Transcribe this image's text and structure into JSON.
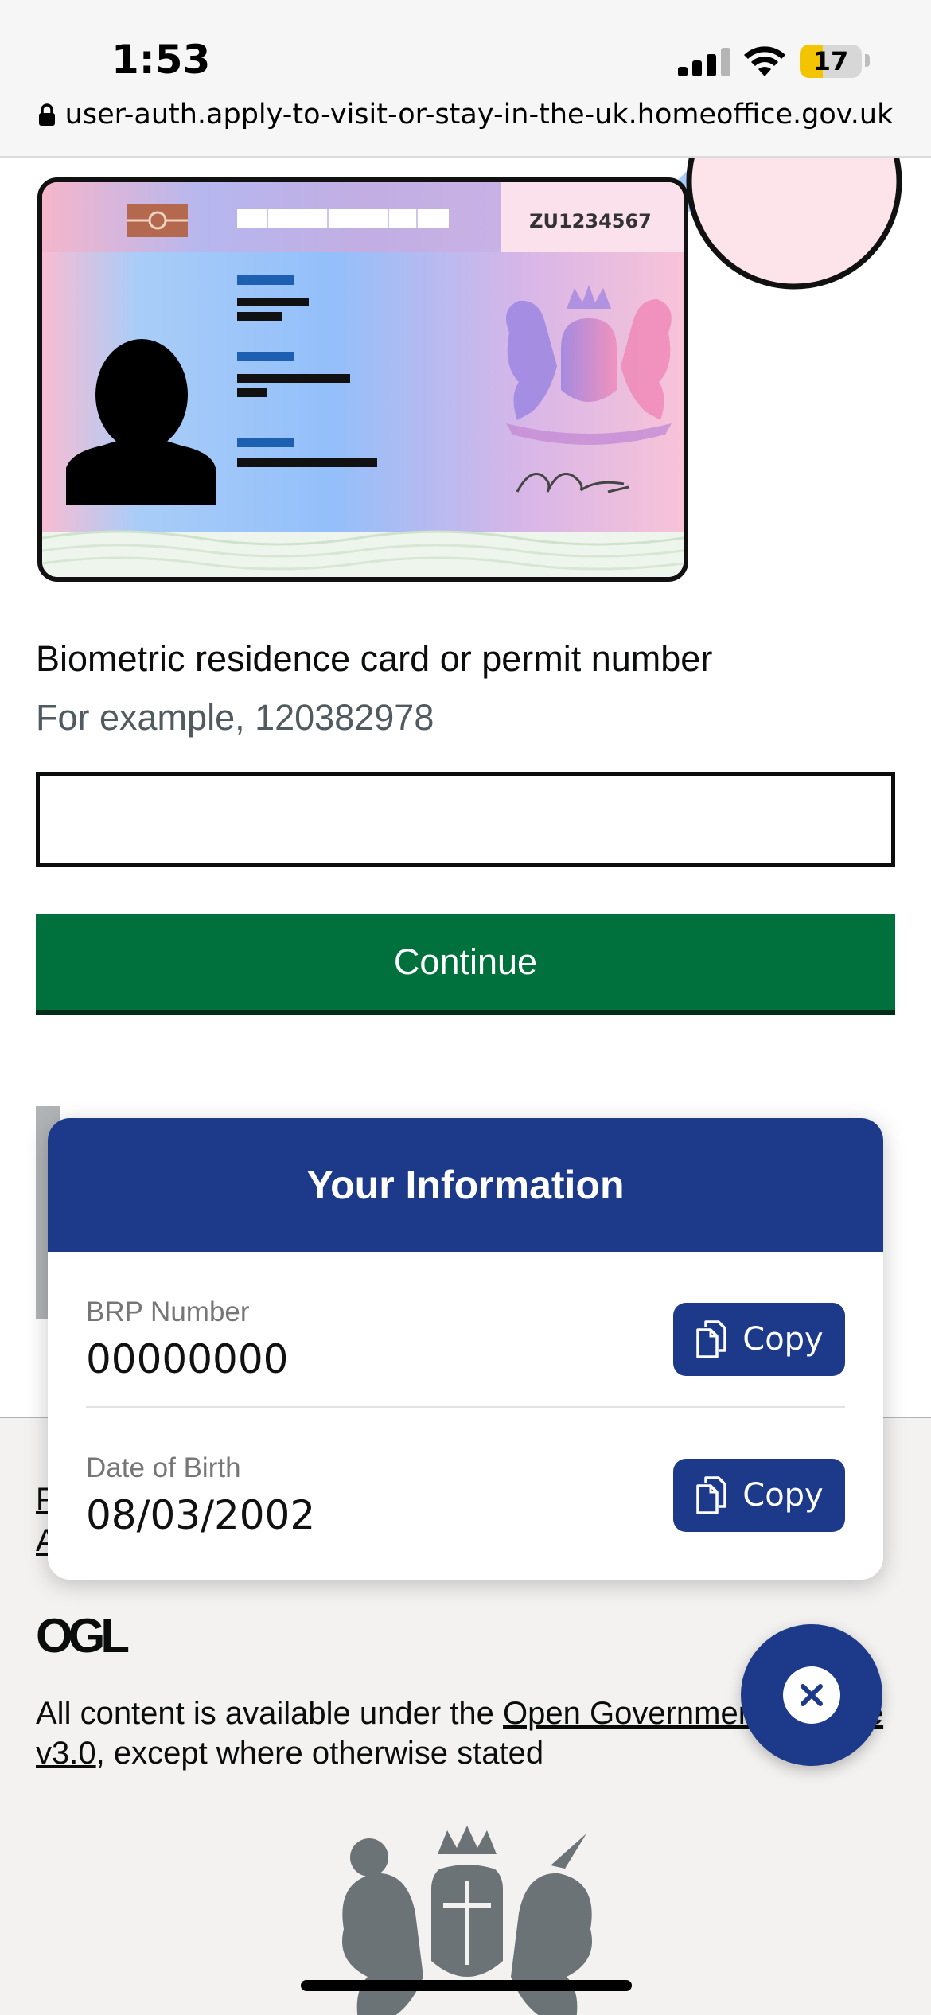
{
  "status_bar": {
    "time": "1:53",
    "battery_level": "17",
    "url": "user-auth.apply-to-visit-or-stay-in-the-uk.homeoffice.gov.uk"
  },
  "brp_card": {
    "card_number": "ZU1234567"
  },
  "form": {
    "label": "Biometric residence card or permit number",
    "hint": "For example, 120382978",
    "input_value": "",
    "continue_label": "Continue"
  },
  "footer": {
    "link1_visible": "P",
    "link2_visible": "A",
    "logo_text": "OGL",
    "licence_prefix": "All content is available under the ",
    "licence_link": "Open Government Licence v3.0",
    "licence_suffix": ", except where otherwise stated"
  },
  "info_panel": {
    "title": "Your Information",
    "rows": [
      {
        "label": "BRP Number",
        "value": "00000000",
        "button": "Copy"
      },
      {
        "label": "Date of Birth",
        "value": "08/03/2002",
        "button": "Copy"
      }
    ]
  },
  "colors": {
    "panel_blue": "#1d3a8a",
    "continue_green": "#00703c",
    "battery_yellow": "#f2c500"
  },
  "icons": [
    "lock-icon",
    "signal-icon",
    "wifi-icon",
    "battery-icon",
    "copy-icon",
    "close-icon"
  ]
}
